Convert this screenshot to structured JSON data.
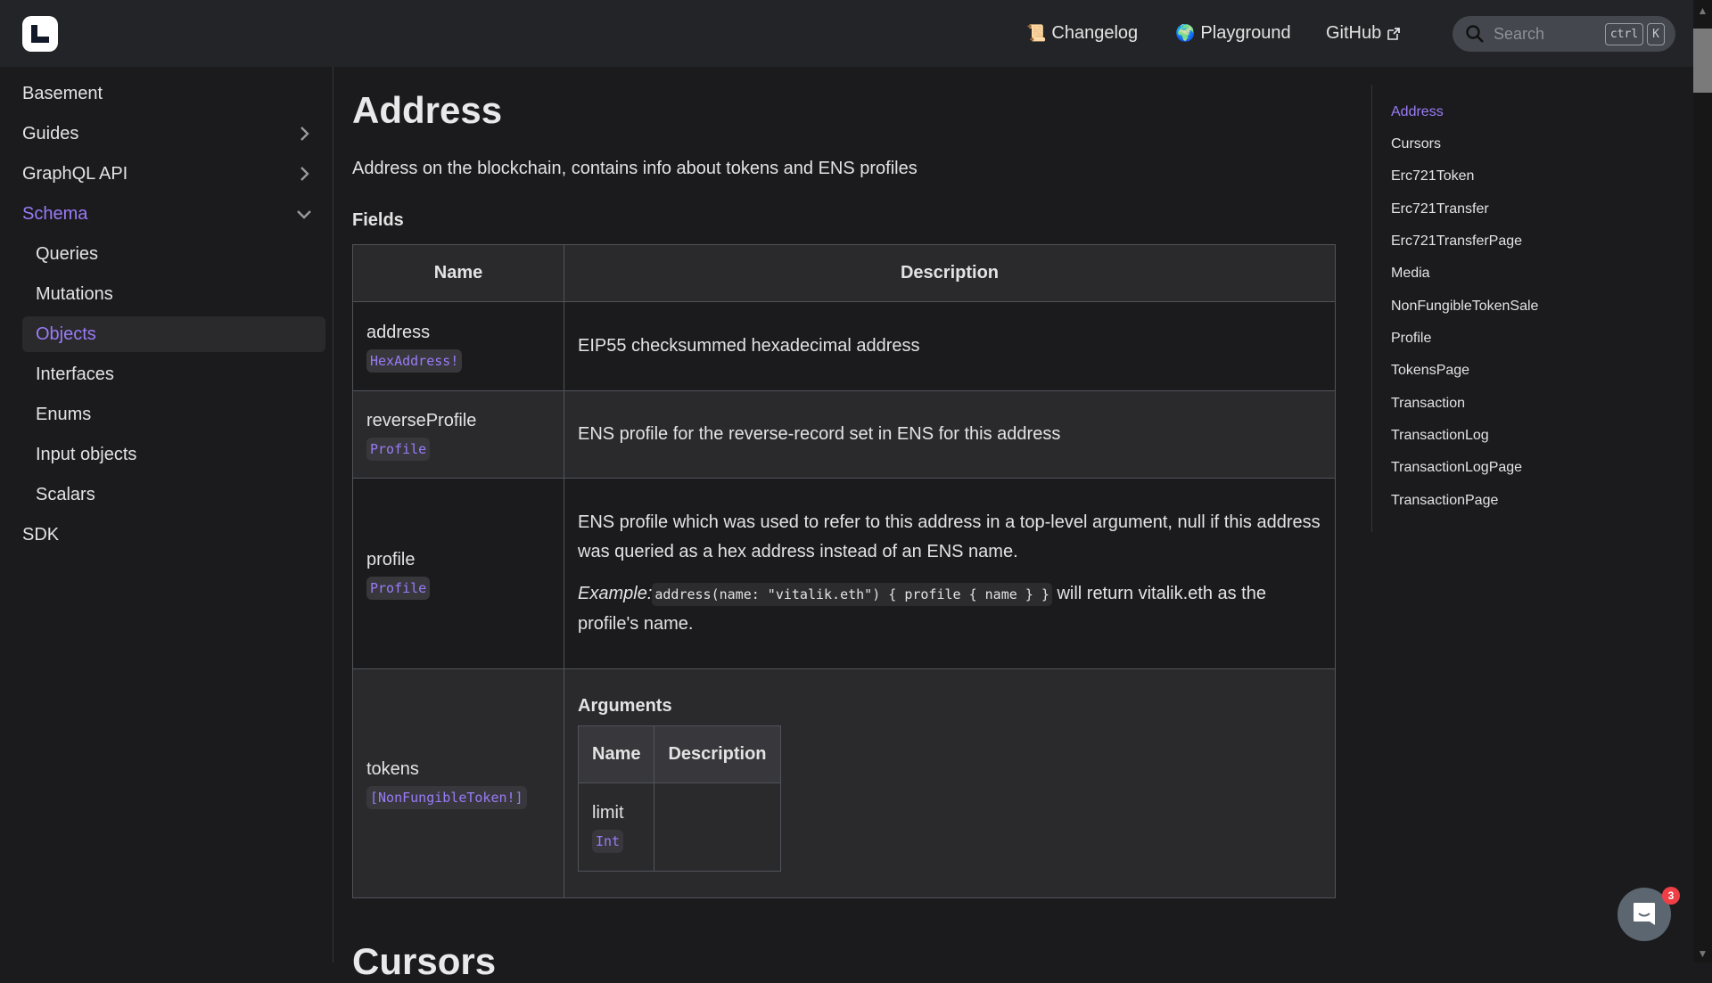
{
  "header": {
    "nav": [
      {
        "label": "Changelog",
        "icon": "scroll-emoji",
        "glyph": "📜"
      },
      {
        "label": "Playground",
        "icon": "globe-emoji",
        "glyph": "🌍"
      },
      {
        "label": "GitHub",
        "icon": "external-link-icon"
      }
    ],
    "search": {
      "placeholder": "Search",
      "shortcut_keys": [
        "ctrl",
        "K"
      ]
    }
  },
  "sidebar": {
    "items": [
      {
        "label": "Basement"
      },
      {
        "label": "Guides",
        "chevron": "right"
      },
      {
        "label": "GraphQL API",
        "chevron": "right"
      },
      {
        "label": "Schema",
        "chevron": "down",
        "active": true
      },
      {
        "label": "Queries",
        "sub": true
      },
      {
        "label": "Mutations",
        "sub": true
      },
      {
        "label": "Objects",
        "sub": true,
        "selected": true
      },
      {
        "label": "Interfaces",
        "sub": true
      },
      {
        "label": "Enums",
        "sub": true
      },
      {
        "label": "Input objects",
        "sub": true
      },
      {
        "label": "Scalars",
        "sub": true
      },
      {
        "label": "SDK"
      }
    ]
  },
  "main": {
    "title": "Address",
    "lead": "Address on the blockchain, contains info about tokens and ENS profiles",
    "fields_heading": "Fields",
    "table": {
      "headers": [
        "Name",
        "Description"
      ],
      "rows": [
        {
          "name": "address",
          "type": "HexAddress!",
          "description": "EIP55 checksummed hexadecimal address"
        },
        {
          "name": "reverseProfile",
          "type": "Profile",
          "description": "ENS profile for the reverse-record set in ENS for this address"
        },
        {
          "name": "profile",
          "type": "Profile",
          "description": "ENS profile which was used to refer to this address in a top-level argument, null if this address was queried as a hex address instead of an ENS name.",
          "example_label": "Example:",
          "example_code": "address(name: \"vitalik.eth\") { profile { name } }",
          "example_suffix": " will return vitalik.eth as the profile's name."
        },
        {
          "name": "tokens",
          "type": "[NonFungibleToken!]",
          "arguments_heading": "Arguments",
          "arguments": {
            "headers": [
              "Name",
              "Description"
            ],
            "rows": [
              {
                "name": "limit",
                "type": "Int",
                "description": ""
              }
            ]
          }
        }
      ]
    },
    "next_heading": "Cursors"
  },
  "toc": {
    "items": [
      "Address",
      "Cursors",
      "Erc721Token",
      "Erc721Transfer",
      "Erc721TransferPage",
      "Media",
      "NonFungibleTokenSale",
      "Profile",
      "TokensPage",
      "Transaction",
      "TransactionLog",
      "TransactionLogPage",
      "TransactionPage"
    ],
    "active_index": 0
  },
  "chat": {
    "badge_count": "3"
  },
  "colors": {
    "accent": "#9a7bf7",
    "background": "#1b1b1d",
    "header": "#232427",
    "badge": "#ef3f46"
  }
}
